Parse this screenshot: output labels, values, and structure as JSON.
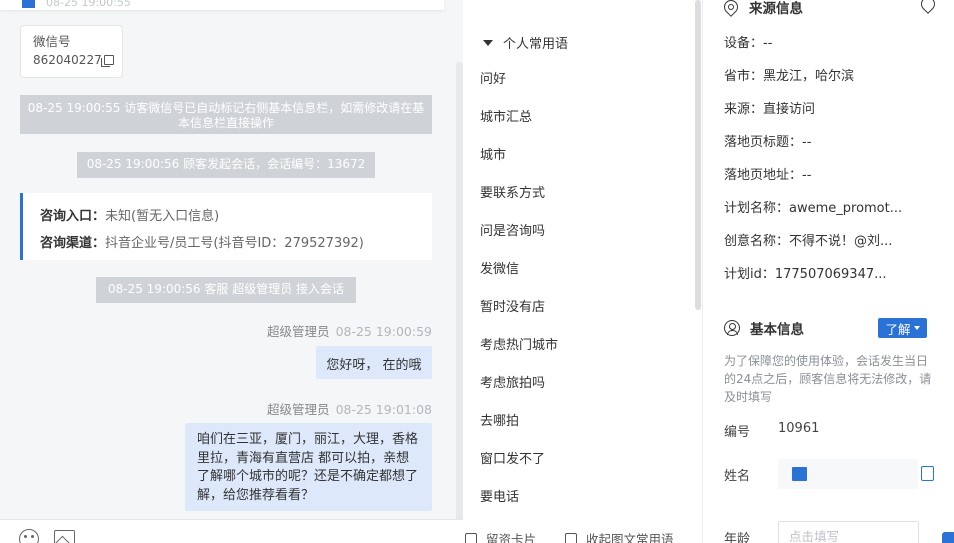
{
  "chat": {
    "top_time": "08-25 19:00:55",
    "wechat_card": {
      "label": "微信号",
      "value": "862040227"
    },
    "system_messages": [
      "08-25 19:00:55 访客微信号已自动标记右侧基本信息栏，如需修改请在基本信息栏直接操作",
      "08-25 19:00:56 顾客发起会话，会话编号：13672",
      "08-25 19:00:56 客服 超级管理员 接入会话"
    ],
    "entry_card": {
      "entry_label": "咨询入口：",
      "entry_value": "未知(暂无入口信息)",
      "channel_label": "咨询渠道：",
      "channel_value": "抖音企业号/员工号(抖音号ID：279527392)"
    },
    "messages": [
      {
        "sender": "超级管理员",
        "time": "08-25 19:00:59",
        "text": "您好呀， 在的哦"
      },
      {
        "sender": "超级管理员",
        "time": "08-25 19:01:08",
        "text": "咱们在三亚，厦门，丽江，大理，香格里拉，青海有直营店 都可以拍，亲想了解哪个城市的呢？还是不确定都想了解，给您推荐看看？"
      }
    ]
  },
  "phrases": {
    "group_title": "个人常用语",
    "items": [
      "问好",
      "城市汇总",
      "城市",
      "要联系方式",
      "问是咨询吗",
      "发微信",
      "暂时没有店",
      "考虑热门城市",
      "考虑旅拍吗",
      "去哪拍",
      "窗口发不了",
      "要电话"
    ],
    "footer_left": "留资卡片",
    "footer_right": "收起图文常用语"
  },
  "info": {
    "source_title": "来源信息",
    "source_rows": [
      "设备：--",
      "省市：黑龙江，哈尔滨",
      "来源：直接访问",
      "落地页标题：--",
      "落地页地址：--",
      "计划名称：aweme_promot...",
      "创意名称：不得不说！@刘...",
      "计划id：177507069347..."
    ],
    "basic_title": "基本信息",
    "learn_more": "了解",
    "notice": "为了保障您的使用体验，会话发生当日的24点之后，顾客信息将无法修改，请及时填写",
    "id_label": "编号",
    "id_value": "10961",
    "name_label": "姓名",
    "age_label": "年龄",
    "age_placeholder": "点击填写"
  },
  "colors": {
    "accent": "#2b72d6",
    "bubble": "#dde9fb",
    "system_bg": "#cfd2d6"
  }
}
